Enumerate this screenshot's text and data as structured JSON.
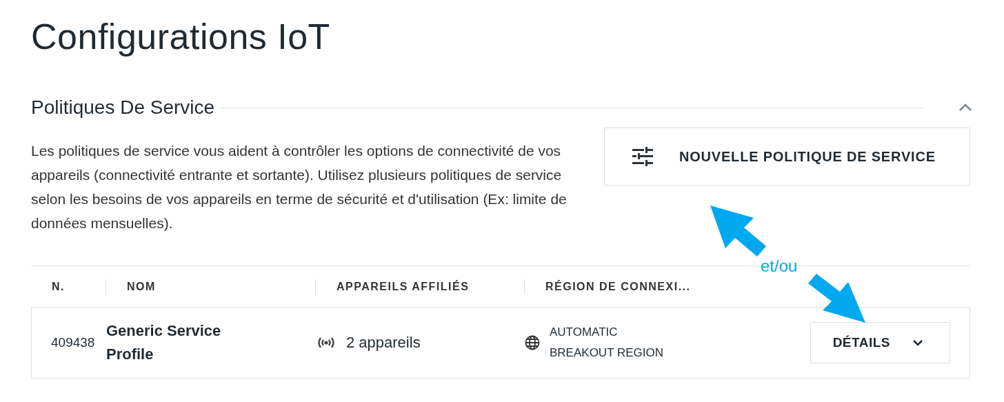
{
  "page": {
    "title": "Configurations IoT"
  },
  "section": {
    "title": "Politiques De Service",
    "expanded": true,
    "description": "Les politiques de service vous aident à contrôler les options de connectivité de vos appareils (connectivité entrante et sortante). Utilisez plusieurs politiques de service selon les besoins de vos appareils en terme de sécurité et d'utilisation (Ex: limite de données mensuelles).",
    "new_button": "NOUVELLE POLITIQUE DE SERVICE"
  },
  "table": {
    "columns": [
      "N.",
      "NOM",
      "APPAREILS AFFILIÉS",
      "RÉGION DE CONNEXI..."
    ],
    "rows": [
      {
        "number": "409438",
        "name": "Generic Service Profile",
        "devices": "2 appareils",
        "region": "AUTOMATIC BREAKOUT REGION",
        "action": "DÉTAILS",
        "expanded": false
      }
    ]
  },
  "annotation": {
    "text": "et/ou"
  }
}
